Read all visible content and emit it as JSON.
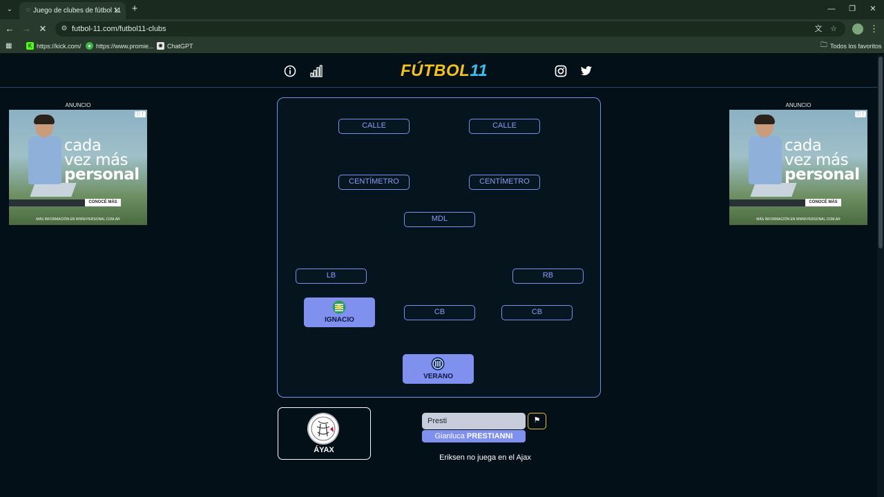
{
  "browser": {
    "tab_title": "Juego de clubes de fútbol 11",
    "url": "futbol-11.com/futbol11-clubs",
    "bookmarks": [
      {
        "label": "https://kick.com/",
        "icon": "kick-icon"
      },
      {
        "label": "https://www.promie...",
        "icon": "globe-icon"
      },
      {
        "label": "ChatGPT",
        "icon": "chatgpt-icon"
      }
    ],
    "all_bookmarks": "Todos los favoritos"
  },
  "site": {
    "logo_text": "FÚTBOL",
    "logo_number": "11"
  },
  "ads": {
    "label": "ANUNCIO",
    "line1": "cada",
    "line2": "vez más",
    "line3": "personal",
    "cta": "CONOCÉ MÁS",
    "footer": "MÁS INFORMACIÓN EN WWW.PERSONAL.COM.AR"
  },
  "pitch": {
    "positions": [
      {
        "label": "CALLE"
      },
      {
        "label": "CALLE"
      },
      {
        "label": "CENTÍMETRO"
      },
      {
        "label": "CENTÍMETRO"
      },
      {
        "label": "MDL"
      },
      {
        "label": "LB"
      },
      {
        "label": "RB"
      },
      {
        "label": "CB"
      },
      {
        "label": "CB"
      }
    ],
    "filled": [
      {
        "name": "IGNACIO",
        "badge": "sporting-badge-icon",
        "color": "#2f9a5a"
      },
      {
        "name": "VERANO",
        "badge": "inter-badge-icon",
        "color": "#0e2a6e"
      }
    ]
  },
  "club": {
    "name": "ÁYAX",
    "logo": "ajax-logo-icon"
  },
  "search": {
    "value": "Presti",
    "suggestion_first": "Gianluca",
    "suggestion_last": "PRESTIANNI"
  },
  "status_message": "Eriksen no juega en el Ajax",
  "colors": {
    "accent": "#7f90ee",
    "logo_yellow": "#f5c21d",
    "logo_blue": "#38c0f0",
    "background": "#041018"
  }
}
